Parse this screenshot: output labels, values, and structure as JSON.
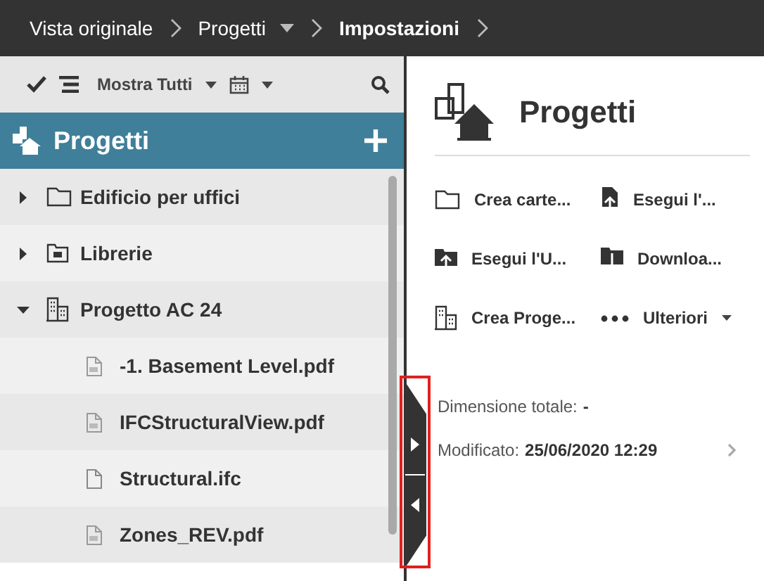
{
  "breadcrumb": [
    {
      "label": "Vista originale",
      "dropdown": false,
      "current": false
    },
    {
      "label": "Progetti",
      "dropdown": true,
      "current": false
    },
    {
      "label": "Impostazioni",
      "dropdown": false,
      "current": true
    }
  ],
  "toolbar": {
    "filter": "Mostra Tutti"
  },
  "sidebar": {
    "title": "Progetti",
    "items": [
      {
        "label": "Edificio per uffici",
        "kind": "folder",
        "expanded": false
      },
      {
        "label": "Librerie",
        "kind": "library",
        "expanded": false
      },
      {
        "label": "Progetto AC 24",
        "kind": "project",
        "expanded": true,
        "children": [
          {
            "label": "-1. Basement Level.pdf",
            "kind": "pdf"
          },
          {
            "label": "IFCStructuralView.pdf",
            "kind": "pdf"
          },
          {
            "label": "Structural.ifc",
            "kind": "file"
          },
          {
            "label": "Zones_REV.pdf",
            "kind": "pdf"
          }
        ]
      }
    ]
  },
  "details": {
    "title": "Progetti",
    "actions": [
      {
        "label": "Crea carte...",
        "kind": "folder"
      },
      {
        "label": "Esegui l'...",
        "kind": "upload-file"
      },
      {
        "label": "Esegui l'U...",
        "kind": "upload-folder"
      },
      {
        "label": "Downloa...",
        "kind": "download"
      },
      {
        "label": "Crea Proge...",
        "kind": "project"
      },
      {
        "label": "Ulteriori",
        "kind": "more"
      }
    ],
    "size_label": "Dimensione totale:",
    "size_value": "-",
    "modified_label": "Modificato:",
    "modified_value": "25/06/2020 12:29"
  }
}
